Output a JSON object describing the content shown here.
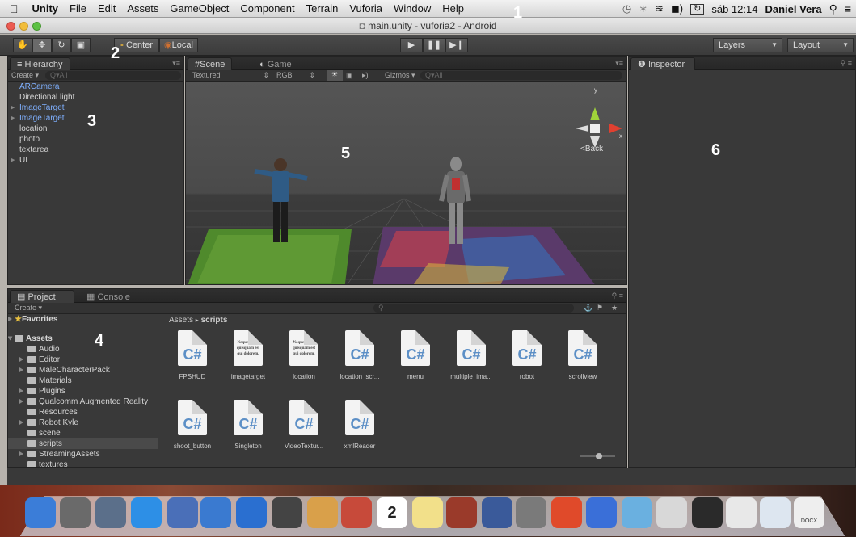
{
  "menubar": {
    "app": "Unity",
    "items": [
      "File",
      "Edit",
      "Assets",
      "GameObject",
      "Component",
      "Terrain",
      "Vuforia",
      "Window",
      "Help"
    ],
    "clock": "sáb 12:14",
    "user": "Daniel Vera"
  },
  "window": {
    "title": "main.unity - vuforia2 - Android"
  },
  "toolbar": {
    "pivot": "Center",
    "space": "Local",
    "layers": "Layers",
    "layout": "Layout"
  },
  "hierarchy": {
    "tab": "Hierarchy",
    "create": "Create",
    "search_placeholder": "Q▾All",
    "items": [
      {
        "label": "ARCamera",
        "color": "#7fb0ff",
        "arrow": false
      },
      {
        "label": "Directional light",
        "color": "#d5d5d5",
        "arrow": false
      },
      {
        "label": "ImageTarget",
        "color": "#7fb0ff",
        "arrow": true
      },
      {
        "label": "ImageTarget",
        "color": "#7fb0ff",
        "arrow": true
      },
      {
        "label": "location",
        "color": "#d5d5d5",
        "arrow": false
      },
      {
        "label": "photo",
        "color": "#d5d5d5",
        "arrow": false
      },
      {
        "label": "textarea",
        "color": "#d5d5d5",
        "arrow": false
      },
      {
        "label": "UI",
        "color": "#d5d5d5",
        "arrow": true
      }
    ]
  },
  "scene": {
    "tab_scene": "Scene",
    "tab_game": "Game",
    "render_mode": "Textured",
    "color_mode": "RGB",
    "gizmos": "Gizmos",
    "search_placeholder": "Q▾All",
    "gizmo_y": "y",
    "gizmo_x": "x",
    "back": "Back"
  },
  "inspector": {
    "tab": "Inspector"
  },
  "project": {
    "tab_project": "Project",
    "tab_console": "Console",
    "create": "Create",
    "favorites": "Favorites",
    "assets_root": "Assets",
    "folders": [
      {
        "label": "Audio",
        "arrow": false,
        "selected": false
      },
      {
        "label": "Editor",
        "arrow": true,
        "selected": false
      },
      {
        "label": "MaleCharacterPack",
        "arrow": true,
        "selected": false
      },
      {
        "label": "Materials",
        "arrow": false,
        "selected": false
      },
      {
        "label": "Plugins",
        "arrow": true,
        "selected": false
      },
      {
        "label": "Qualcomm Augmented Reality",
        "arrow": true,
        "selected": false
      },
      {
        "label": "Resources",
        "arrow": false,
        "selected": false
      },
      {
        "label": "Robot Kyle",
        "arrow": true,
        "selected": false
      },
      {
        "label": "scene",
        "arrow": false,
        "selected": false
      },
      {
        "label": "scripts",
        "arrow": false,
        "selected": true
      },
      {
        "label": "StreamingAssets",
        "arrow": true,
        "selected": false
      },
      {
        "label": "textures",
        "arrow": false,
        "selected": false
      }
    ],
    "breadcrumb_root": "Assets",
    "breadcrumb_leaf": "scripts",
    "doc_text": "Neque porro quisquam est qui dolorem.",
    "csharp_glyph": "C#",
    "assets": [
      {
        "label": "FPSHUD",
        "kind": "cs"
      },
      {
        "label": "imagetarget",
        "kind": "txt"
      },
      {
        "label": "location",
        "kind": "txt"
      },
      {
        "label": "location_scr...",
        "kind": "cs"
      },
      {
        "label": "menu",
        "kind": "cs"
      },
      {
        "label": "multiple_ima...",
        "kind": "cs"
      },
      {
        "label": "robot",
        "kind": "cs"
      },
      {
        "label": "scrollview",
        "kind": "cs"
      },
      {
        "label": "shoot_button",
        "kind": "cs"
      },
      {
        "label": "Singleton",
        "kind": "cs"
      },
      {
        "label": "VideoTextur...",
        "kind": "cs"
      },
      {
        "label": "xmlReader",
        "kind": "cs"
      }
    ]
  },
  "callouts": [
    "1",
    "2",
    "3",
    "4",
    "5",
    "6"
  ],
  "dock": {
    "docx_label": "DOCX",
    "calendar_day": "2",
    "icon_colors": [
      "#3b7dd8",
      "#6a6a6a",
      "#5b6f8a",
      "#2d8fe6",
      "#4a6fb8",
      "#3a7ad0",
      "#2a6fd0",
      "#444",
      "#d9a04a",
      "#c74a3a",
      "#e8e8e8",
      "#f2e08a",
      "#9a3a2a",
      "#3a5a9a",
      "#7a7a7a",
      "#e04a2a",
      "#3a6fd8",
      "#6ab0e0",
      "#d8d8d8",
      "#2a2a2a",
      "#e8e8e8",
      "#dde6f0",
      "#8fb8e8",
      "#9a9a9a"
    ]
  }
}
